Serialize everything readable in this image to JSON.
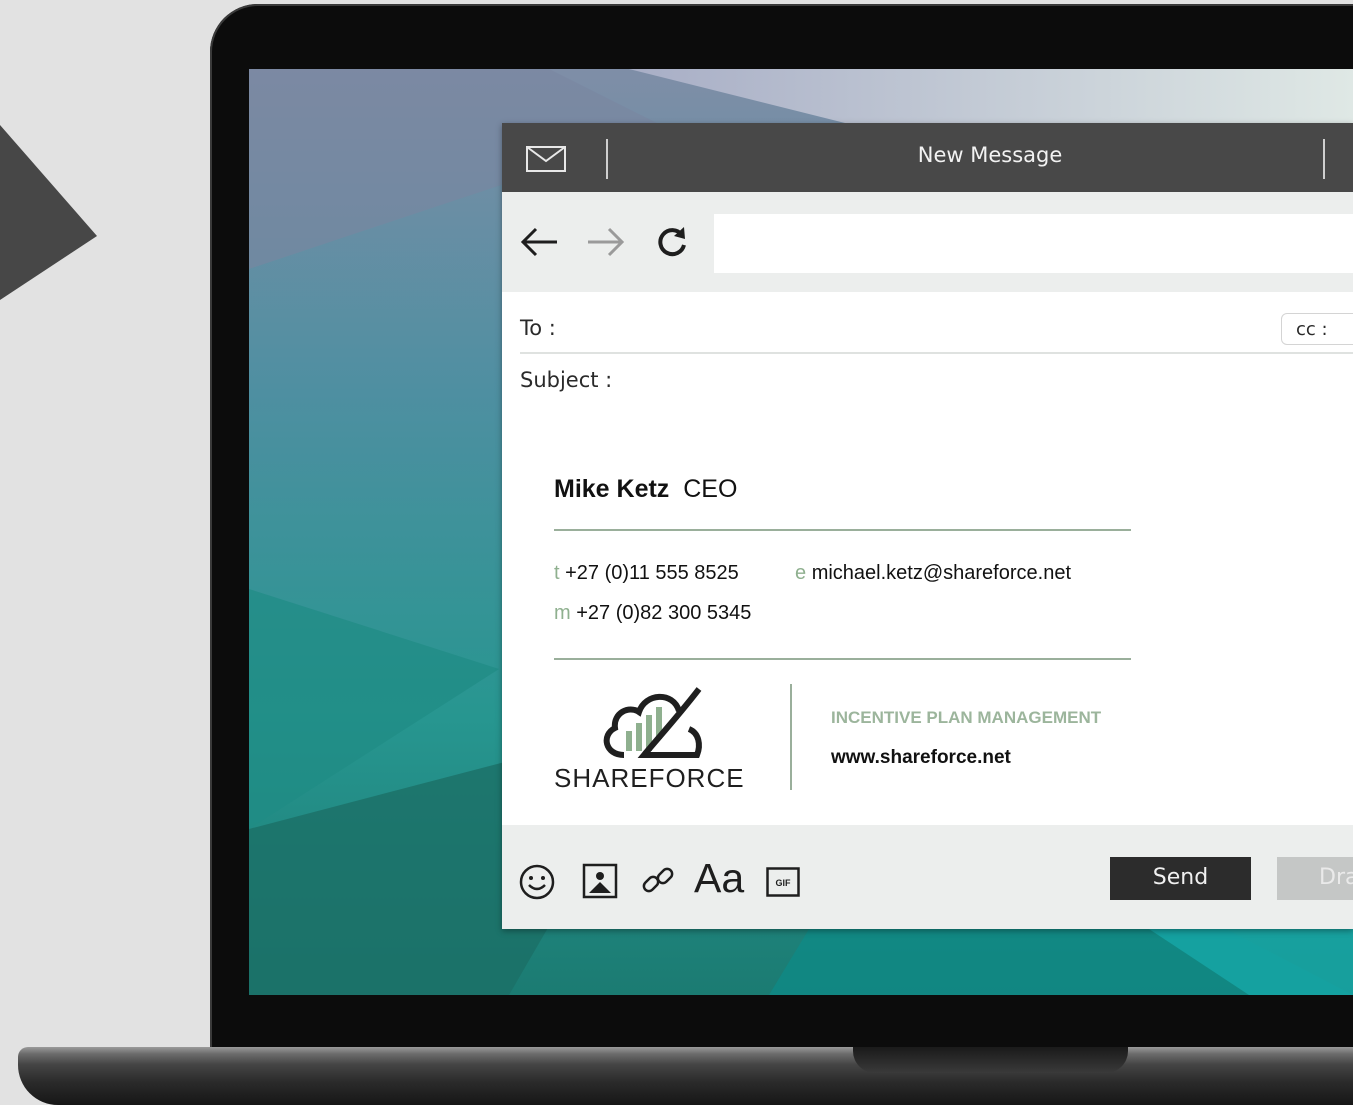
{
  "window": {
    "title": "New Message"
  },
  "compose": {
    "to_label": "To :",
    "cc_label": "cc :",
    "subject_label": "Subject :",
    "url_value": ""
  },
  "signature": {
    "name": "Mike Ketz",
    "role": "CEO",
    "tel_prefix": "t",
    "tel": "+27 (0)11 555 8525",
    "email_prefix": "e",
    "email": "michael.ketz@shareforce.net",
    "mobile_prefix": "m",
    "mobile": "+27 (0)82 300 5345",
    "logo_bold": "SHARE",
    "logo_light": "FORCE",
    "tagline": "INCENTIVE PLAN MANAGEMENT",
    "website": "www.shareforce.net"
  },
  "toolbar": {
    "font_label": "Aa",
    "gif_label": "GIF",
    "send_label": "Send",
    "draft_label": "Dra"
  },
  "colors": {
    "accent_green": "#8fb08f",
    "titlebar": "#484848",
    "send_bg": "#2c2c2c"
  }
}
